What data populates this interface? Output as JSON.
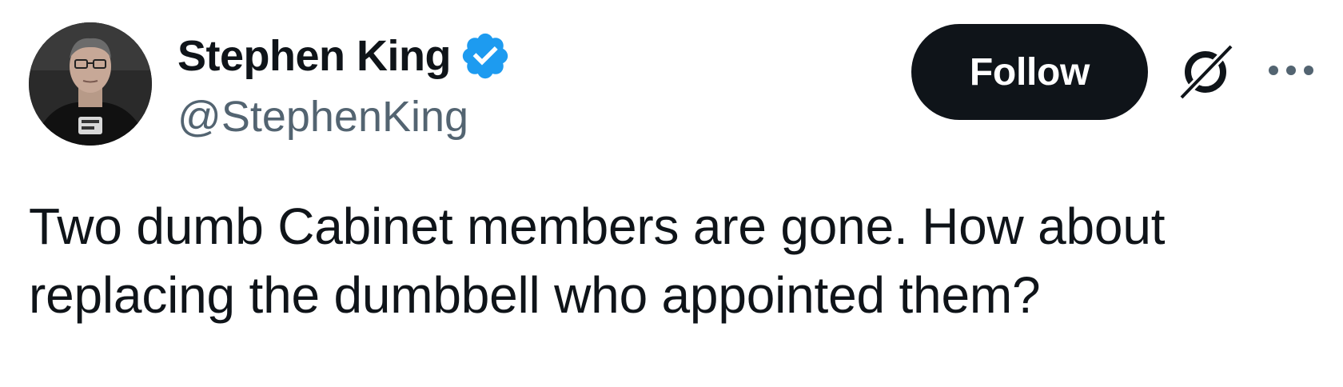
{
  "author": {
    "display_name": "Stephen King",
    "handle": "@StephenKing",
    "verified": true,
    "verified_color": "#1d9bf0"
  },
  "actions": {
    "follow_label": "Follow",
    "grok_icon": "grok-icon",
    "more_icon": "more-icon"
  },
  "tweet": {
    "text_lines": [
      "Two dumb Cabinet members are gone. How about",
      "replacing the dumbbell who appointed them?"
    ]
  },
  "colors": {
    "text": "#0f1419",
    "secondary": "#536471",
    "follow_bg": "#0f1419",
    "follow_fg": "#ffffff"
  }
}
